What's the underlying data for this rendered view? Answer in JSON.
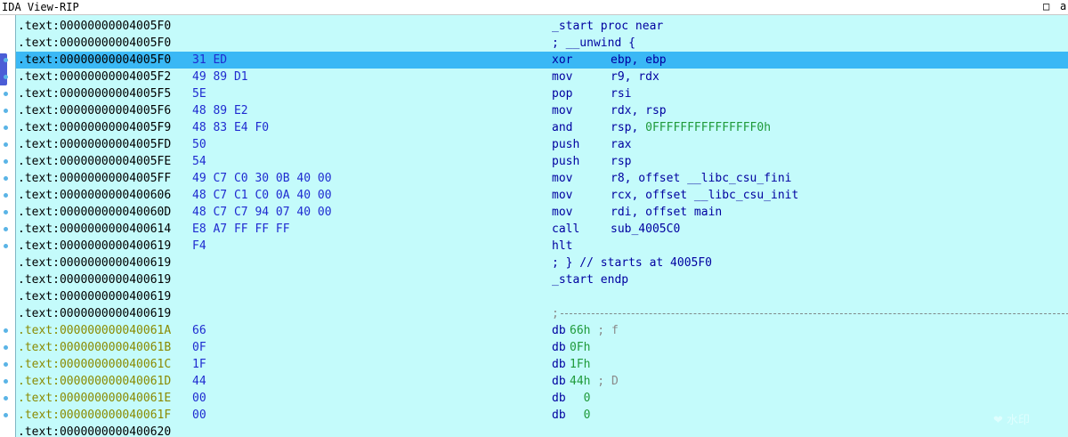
{
  "window": {
    "title": "IDA View-RIP",
    "restore_glyph": "□",
    "extra_glyph": "a"
  },
  "rows": [
    {
      "addr": ".text:00000000004005F0",
      "bytes": "",
      "mnemonic": "",
      "operands": "",
      "label": "_start proc near"
    },
    {
      "addr": ".text:00000000004005F0",
      "bytes": "",
      "mnemonic": "",
      "operands": "",
      "label": "; __unwind {"
    },
    {
      "addr": ".text:00000000004005F0",
      "bytes": "31 ED",
      "mnemonic": "xor",
      "operands": "ebp, ebp",
      "selected": true
    },
    {
      "addr": ".text:00000000004005F2",
      "bytes": "49 89 D1",
      "mnemonic": "mov",
      "operands": "r9, rdx"
    },
    {
      "addr": ".text:00000000004005F5",
      "bytes": "5E",
      "mnemonic": "pop",
      "operands": "rsi"
    },
    {
      "addr": ".text:00000000004005F6",
      "bytes": "48 89 E2",
      "mnemonic": "mov",
      "operands": "rdx, rsp"
    },
    {
      "addr": ".text:00000000004005F9",
      "bytes": "48 83 E4 F0",
      "mnemonic": "and",
      "operands": "rsp, ",
      "operands_num": "0FFFFFFFFFFFFFFF0h"
    },
    {
      "addr": ".text:00000000004005FD",
      "bytes": "50",
      "mnemonic": "push",
      "operands": "rax"
    },
    {
      "addr": ".text:00000000004005FE",
      "bytes": "54",
      "mnemonic": "push",
      "operands": "rsp"
    },
    {
      "addr": ".text:00000000004005FF",
      "bytes": "49 C7 C0 30 0B 40 00",
      "mnemonic": "mov",
      "operands": "r8, offset __libc_csu_fini"
    },
    {
      "addr": ".text:0000000000400606",
      "bytes": "48 C7 C1 C0 0A 40 00",
      "mnemonic": "mov",
      "operands": "rcx, offset __libc_csu_init"
    },
    {
      "addr": ".text:000000000040060D",
      "bytes": "48 C7 C7 94 07 40 00",
      "mnemonic": "mov",
      "operands": "rdi, offset main"
    },
    {
      "addr": ".text:0000000000400614",
      "bytes": "E8 A7 FF FF FF",
      "mnemonic": "call",
      "operands": "sub_4005C0"
    },
    {
      "addr": ".text:0000000000400619",
      "bytes": "F4",
      "mnemonic": "hlt",
      "operands": ""
    },
    {
      "addr": ".text:0000000000400619",
      "bytes": "",
      "mnemonic": "",
      "operands": "",
      "label": "; } // starts at 4005F0"
    },
    {
      "addr": ".text:0000000000400619",
      "bytes": "",
      "mnemonic": "",
      "operands": "",
      "label": "_start endp"
    },
    {
      "addr": ".text:0000000000400619",
      "bytes": "",
      "mnemonic": "",
      "operands": ""
    },
    {
      "addr": ".text:0000000000400619",
      "bytes": "",
      "mnemonic": "",
      "operands": "",
      "separator": ";"
    },
    {
      "addr": ".text:000000000040061A",
      "bytes": "66",
      "mnemonic": "db",
      "operands_num": "66h",
      "comment": " ; f",
      "data": true
    },
    {
      "addr": ".text:000000000040061B",
      "bytes": "0F",
      "mnemonic": "db",
      "operands_num": "0Fh",
      "data": true
    },
    {
      "addr": ".text:000000000040061C",
      "bytes": "1F",
      "mnemonic": "db",
      "operands_num": "1Fh",
      "data": true
    },
    {
      "addr": ".text:000000000040061D",
      "bytes": "44",
      "mnemonic": "db",
      "operands_num": "44h",
      "comment": " ; D",
      "data": true
    },
    {
      "addr": ".text:000000000040061E",
      "bytes": "00",
      "mnemonic": "db",
      "operands_num": "  0",
      "data": true
    },
    {
      "addr": ".text:000000000040061F",
      "bytes": "00",
      "mnemonic": "db",
      "operands_num": "  0",
      "data": true
    },
    {
      "addr": ".text:0000000000400620",
      "bytes": "",
      "mnemonic": "",
      "operands": ""
    }
  ],
  "colors": {
    "background": "#c4fbfb",
    "selection": "#3ab8f5",
    "bytes": "#1f2bd0",
    "numbers": "#1f9a3a",
    "code": "#0000a0"
  },
  "watermark": "❤ 水印"
}
